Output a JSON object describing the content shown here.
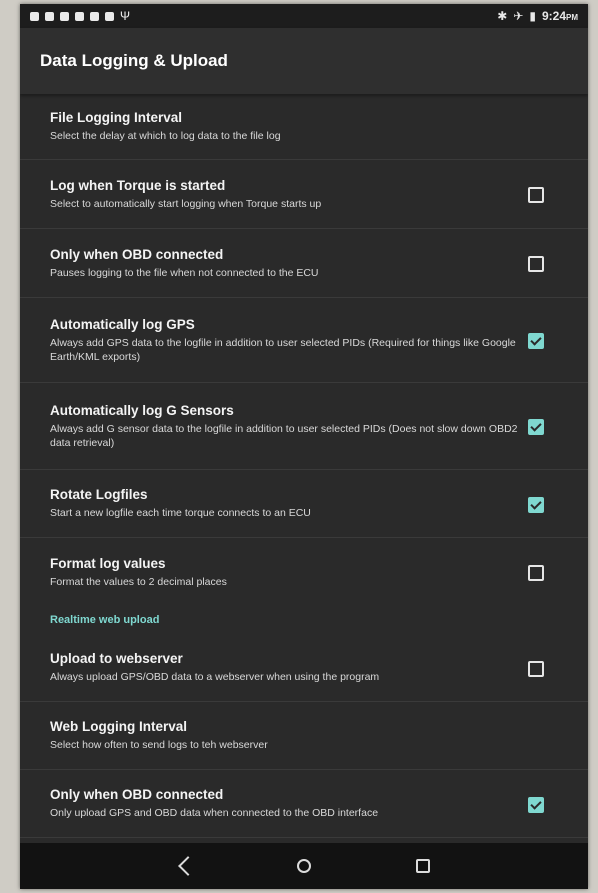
{
  "status_bar": {
    "time": "9:24",
    "ampm": "PM",
    "icons": [
      "bluetooth-icon",
      "airplane-mode-icon",
      "battery-icon"
    ]
  },
  "app_bar": {
    "title": "Data Logging & Upload"
  },
  "settings": [
    {
      "title": "File Logging Interval",
      "summary": "Select the delay at which to log data to the file log",
      "has_checkbox": false
    },
    {
      "title": "Log when Torque is started",
      "summary": "Select to automatically start logging when Torque starts up",
      "has_checkbox": true,
      "checked": false
    },
    {
      "title": "Only when OBD connected",
      "summary": "Pauses logging to the file when not connected to the ECU",
      "has_checkbox": true,
      "checked": false
    },
    {
      "title": "Automatically log GPS",
      "summary": "Always add GPS data to the logfile in addition to user selected PIDs (Required for things like Google Earth/KML exports)",
      "has_checkbox": true,
      "checked": true
    },
    {
      "title": "Automatically log G Sensors",
      "summary": "Always add G sensor data to the logfile in addition to user selected PIDs (Does not slow down OBD2 data retrieval)",
      "has_checkbox": true,
      "checked": true
    },
    {
      "title": "Rotate Logfiles",
      "summary": "Start a new logfile each time torque connects to an ECU",
      "has_checkbox": true,
      "checked": true
    },
    {
      "title": "Format log values",
      "summary": "Format the values to 2 decimal places",
      "has_checkbox": true,
      "checked": false
    }
  ],
  "section_web": {
    "header": "Realtime web upload"
  },
  "web_settings": [
    {
      "title": "Upload to webserver",
      "summary": "Always upload GPS/OBD data to a webserver when using the program",
      "has_checkbox": true,
      "checked": false
    },
    {
      "title": "Web Logging Interval",
      "summary": "Select how often to send logs to teh webserver",
      "has_checkbox": false
    },
    {
      "title": "Only when OBD connected",
      "summary": "Only upload GPS and OBD data when connected to the OBD interface",
      "has_checkbox": true,
      "checked": true
    }
  ],
  "colors": {
    "accent": "#7fd8d0",
    "background": "#2a2a2a",
    "app_bar": "#2f2f2f"
  }
}
